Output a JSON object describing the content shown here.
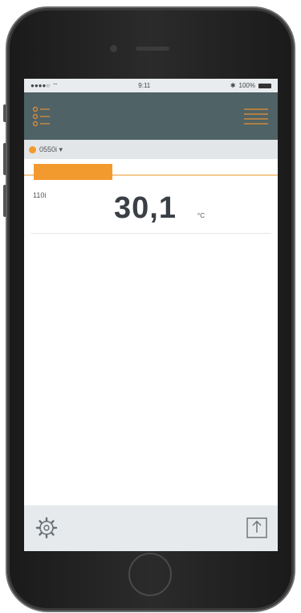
{
  "status_bar": {
    "carrier": "●●●●○ ",
    "time": "9:11",
    "battery": "100%"
  },
  "header": {
    "menu_icon": "menu-icon",
    "list_icon": "list-view-icon"
  },
  "device": {
    "name": "0550i ▾"
  },
  "probe": {
    "label": "110i"
  },
  "reading": {
    "value": "30,1",
    "unit": "°C"
  },
  "progress": {
    "fraction": 0.35
  },
  "footer": {
    "settings_icon": "gear-icon",
    "export_icon": "export-icon"
  },
  "colors": {
    "accent": "#f39a2e",
    "header": "#4f6265"
  }
}
